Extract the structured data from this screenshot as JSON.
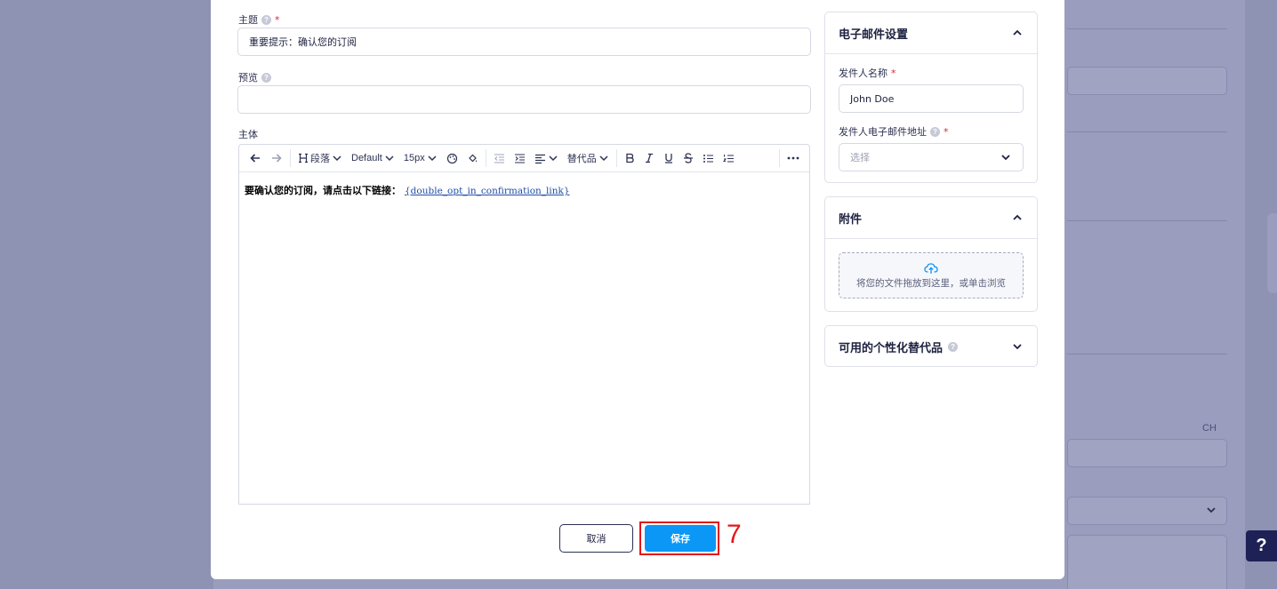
{
  "background": {
    "lang_selector": "CH"
  },
  "form": {
    "subject": {
      "label": "主题",
      "value": "重要提示：确认您的订阅"
    },
    "preview": {
      "label": "预览",
      "value": ""
    },
    "body": {
      "label": "主体",
      "text": "要确认您的订阅，请点击以下链接：",
      "link": "{double_opt_in_confirmation_link}"
    },
    "toolbar": {
      "paragraph": "段落",
      "font": "Default",
      "size": "15px",
      "substitutions": "替代品"
    }
  },
  "actions": {
    "cancel": "取消",
    "save": "保存",
    "step_marker": "7"
  },
  "email_settings": {
    "title": "电子邮件设置",
    "sender_name_label": "发件人名称",
    "sender_name_value": "John Doe",
    "sender_email_label": "发件人电子邮件地址",
    "sender_email_placeholder": "选择"
  },
  "attachments": {
    "title": "附件",
    "dropzone_text": "将您的文件拖放到这里，或单击浏览"
  },
  "personalization": {
    "title": "可用的个性化替代品"
  },
  "help_button": "?",
  "colors": {
    "primary": "#0a97f5",
    "highlight": "#e3161b",
    "navy": "#1d2155"
  }
}
